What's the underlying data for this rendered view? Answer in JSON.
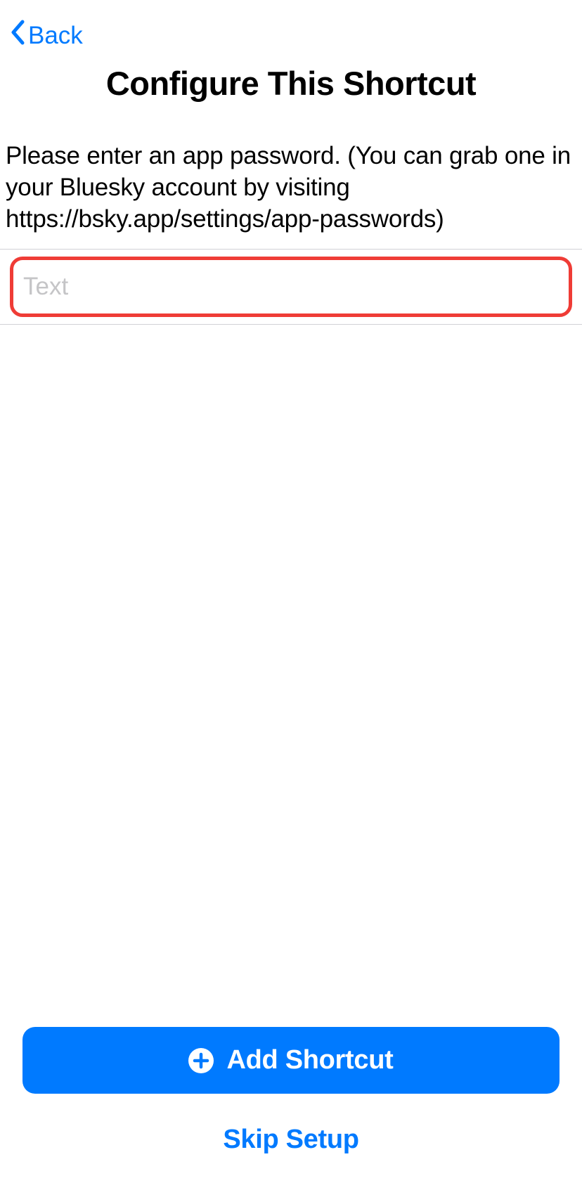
{
  "nav": {
    "back_label": "Back"
  },
  "header": {
    "title": "Configure This Shortcut"
  },
  "instruction_text": "Please enter an app password. (You can grab one in your Bluesky account by visiting https://bsky.app/settings/app-passwords)",
  "input": {
    "placeholder": "Text",
    "value": ""
  },
  "footer": {
    "add_label": "Add Shortcut",
    "skip_label": "Skip Setup"
  }
}
